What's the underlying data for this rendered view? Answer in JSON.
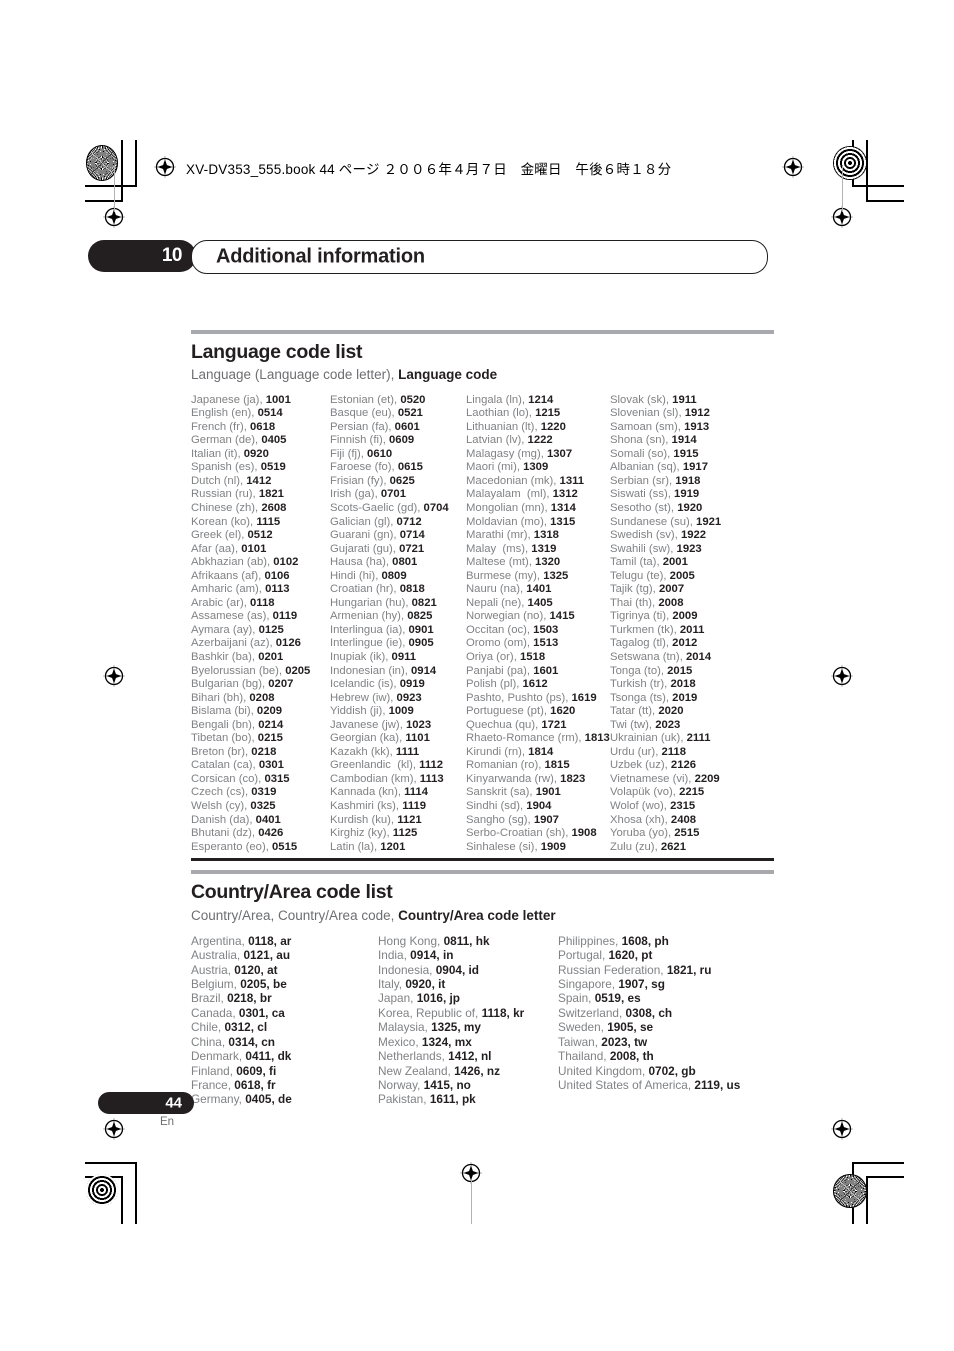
{
  "book_header": "XV-DV353_555.book  44 ページ  ２００６年４月７日　金曜日　午後６時１８分",
  "chapter": {
    "number": "10",
    "title": "Additional information"
  },
  "footer": {
    "page_number": "44",
    "language_mark": "En"
  },
  "sections": [
    {
      "id": "language-code-list",
      "title": "Language code list",
      "subtitle_plain": "Language (Language code letter), ",
      "subtitle_bold": "Language code",
      "columns": [
        [
          {
            "name": "Japanese (ja), ",
            "code": "1001"
          },
          {
            "name": "English (en), ",
            "code": "0514"
          },
          {
            "name": "French (fr), ",
            "code": "0618"
          },
          {
            "name": "German (de), ",
            "code": "0405"
          },
          {
            "name": "Italian (it), ",
            "code": "0920"
          },
          {
            "name": "Spanish (es), ",
            "code": "0519"
          },
          {
            "name": "Dutch (nl), ",
            "code": "1412"
          },
          {
            "name": "Russian (ru), ",
            "code": "1821"
          },
          {
            "name": "Chinese (zh), ",
            "code": "2608"
          },
          {
            "name": "Korean (ko), ",
            "code": "1115"
          },
          {
            "name": "Greek (el), ",
            "code": "0512"
          },
          {
            "name": "Afar (aa), ",
            "code": "0101"
          },
          {
            "name": "Abkhazian (ab), ",
            "code": "0102"
          },
          {
            "name": "Afrikaans (af), ",
            "code": "0106"
          },
          {
            "name": "Amharic (am), ",
            "code": "0113"
          },
          {
            "name": "Arabic (ar), ",
            "code": "0118"
          },
          {
            "name": "Assamese (as), ",
            "code": "0119"
          },
          {
            "name": "Aymara (ay), ",
            "code": "0125"
          },
          {
            "name": "Azerbaijani (az), ",
            "code": "0126"
          },
          {
            "name": "Bashkir (ba), ",
            "code": "0201"
          },
          {
            "name": "Byelorussian (be), ",
            "code": "0205"
          },
          {
            "name": "Bulgarian (bg), ",
            "code": "0207"
          },
          {
            "name": "Bihari (bh), ",
            "code": "0208"
          },
          {
            "name": "Bislama (bi), ",
            "code": "0209"
          },
          {
            "name": "Bengali (bn), ",
            "code": "0214"
          },
          {
            "name": "Tibetan (bo), ",
            "code": "0215"
          },
          {
            "name": "Breton (br), ",
            "code": "0218"
          },
          {
            "name": "Catalan (ca), ",
            "code": "0301"
          },
          {
            "name": "Corsican (co), ",
            "code": "0315"
          },
          {
            "name": "Czech (cs), ",
            "code": "0319"
          },
          {
            "name": "Welsh (cy), ",
            "code": "0325"
          },
          {
            "name": "Danish (da), ",
            "code": "0401"
          },
          {
            "name": "Bhutani (dz), ",
            "code": "0426"
          },
          {
            "name": "Esperanto (eo), ",
            "code": "0515"
          }
        ],
        [
          {
            "name": "Estonian (et), ",
            "code": "0520"
          },
          {
            "name": "Basque (eu), ",
            "code": "0521"
          },
          {
            "name": "Persian (fa), ",
            "code": "0601"
          },
          {
            "name": "Finnish (fi), ",
            "code": "0609"
          },
          {
            "name": "Fiji (fj), ",
            "code": "0610"
          },
          {
            "name": "Faroese (fo), ",
            "code": "0615"
          },
          {
            "name": "Frisian (fy), ",
            "code": "0625"
          },
          {
            "name": "Irish (ga), ",
            "code": "0701"
          },
          {
            "name": "Scots-Gaelic (gd), ",
            "code": "0704"
          },
          {
            "name": "Galician (gl), ",
            "code": "0712"
          },
          {
            "name": "Guarani (gn), ",
            "code": "0714"
          },
          {
            "name": "Gujarati (gu), ",
            "code": "0721"
          },
          {
            "name": "Hausa (ha), ",
            "code": "0801"
          },
          {
            "name": "Hindi (hi), ",
            "code": "0809"
          },
          {
            "name": "Croatian (hr), ",
            "code": "0818"
          },
          {
            "name": "Hungarian (hu), ",
            "code": "0821"
          },
          {
            "name": "Armenian (hy), ",
            "code": "0825"
          },
          {
            "name": "Interlingua (ia), ",
            "code": "0901"
          },
          {
            "name": "Interlingue (ie), ",
            "code": "0905"
          },
          {
            "name": "Inupiak (ik), ",
            "code": "0911"
          },
          {
            "name": "Indonesian (in), ",
            "code": "0914"
          },
          {
            "name": "Icelandic (is), ",
            "code": "0919"
          },
          {
            "name": "Hebrew (iw), ",
            "code": "0923"
          },
          {
            "name": "Yiddish (ji), ",
            "code": "1009"
          },
          {
            "name": "Javanese (jw), ",
            "code": "1023"
          },
          {
            "name": "Georgian (ka), ",
            "code": "1101"
          },
          {
            "name": "Kazakh (kk), ",
            "code": "1111"
          },
          {
            "name": "Greenlandic  (kl), ",
            "code": "1112"
          },
          {
            "name": "Cambodian (km), ",
            "code": "1113"
          },
          {
            "name": "Kannada (kn), ",
            "code": "1114"
          },
          {
            "name": "Kashmiri (ks), ",
            "code": "1119"
          },
          {
            "name": "Kurdish (ku), ",
            "code": "1121"
          },
          {
            "name": "Kirghiz (ky), ",
            "code": "1125"
          },
          {
            "name": "Latin (la), ",
            "code": "1201"
          }
        ],
        [
          {
            "name": "Lingala (ln), ",
            "code": "1214"
          },
          {
            "name": "Laothian (lo), ",
            "code": "1215"
          },
          {
            "name": "Lithuanian (lt), ",
            "code": "1220"
          },
          {
            "name": "Latvian (lv), ",
            "code": "1222"
          },
          {
            "name": "Malagasy (mg), ",
            "code": "1307"
          },
          {
            "name": "Maori (mi), ",
            "code": "1309"
          },
          {
            "name": "Macedonian (mk), ",
            "code": "1311"
          },
          {
            "name": "Malayalam  (ml), ",
            "code": "1312"
          },
          {
            "name": "Mongolian (mn), ",
            "code": "1314"
          },
          {
            "name": "Moldavian (mo), ",
            "code": "1315"
          },
          {
            "name": "Marathi (mr), ",
            "code": "1318"
          },
          {
            "name": "Malay  (ms), ",
            "code": "1319"
          },
          {
            "name": "Maltese (mt), ",
            "code": "1320"
          },
          {
            "name": "Burmese (my), ",
            "code": "1325"
          },
          {
            "name": "Nauru (na), ",
            "code": "1401"
          },
          {
            "name": "Nepali (ne), ",
            "code": "1405"
          },
          {
            "name": "Norwegian (no), ",
            "code": "1415"
          },
          {
            "name": "Occitan (oc), ",
            "code": "1503"
          },
          {
            "name": "Oromo (om), ",
            "code": "1513"
          },
          {
            "name": "Oriya (or), ",
            "code": "1518"
          },
          {
            "name": "Panjabi (pa), ",
            "code": "1601"
          },
          {
            "name": "Polish (pl), ",
            "code": "1612"
          },
          {
            "name": "Pashto, Pushto (ps), ",
            "code": "1619"
          },
          {
            "name": "Portuguese (pt), ",
            "code": "1620"
          },
          {
            "name": "Quechua (qu), ",
            "code": "1721"
          },
          {
            "name": "Rhaeto-Romance (rm), ",
            "code": "1813"
          },
          {
            "name": "Kirundi (rn), ",
            "code": "1814"
          },
          {
            "name": "Romanian (ro), ",
            "code": "1815"
          },
          {
            "name": "Kinyarwanda (rw), ",
            "code": "1823"
          },
          {
            "name": "Sanskrit (sa), ",
            "code": "1901"
          },
          {
            "name": "Sindhi (sd), ",
            "code": "1904"
          },
          {
            "name": "Sangho (sg), ",
            "code": "1907"
          },
          {
            "name": "Serbo-Croatian (sh), ",
            "code": "1908"
          },
          {
            "name": "Sinhalese (si), ",
            "code": "1909"
          }
        ],
        [
          {
            "name": "Slovak (sk), ",
            "code": "1911"
          },
          {
            "name": "Slovenian (sl), ",
            "code": "1912"
          },
          {
            "name": "Samoan (sm), ",
            "code": "1913"
          },
          {
            "name": "Shona (sn), ",
            "code": "1914"
          },
          {
            "name": "Somali (so), ",
            "code": "1915"
          },
          {
            "name": "Albanian (sq), ",
            "code": "1917"
          },
          {
            "name": "Serbian (sr), ",
            "code": "1918"
          },
          {
            "name": "Siswati (ss), ",
            "code": "1919"
          },
          {
            "name": "Sesotho (st), ",
            "code": "1920"
          },
          {
            "name": "Sundanese (su), ",
            "code": "1921"
          },
          {
            "name": "Swedish (sv), ",
            "code": "1922"
          },
          {
            "name": "Swahili (sw), ",
            "code": "1923"
          },
          {
            "name": "Tamil (ta), ",
            "code": "2001"
          },
          {
            "name": "Telugu (te), ",
            "code": "2005"
          },
          {
            "name": "Tajik (tg), ",
            "code": "2007"
          },
          {
            "name": "Thai (th), ",
            "code": "2008"
          },
          {
            "name": "Tigrinya (ti), ",
            "code": "2009"
          },
          {
            "name": "Turkmen (tk), ",
            "code": "2011"
          },
          {
            "name": "Tagalog (tl), ",
            "code": "2012"
          },
          {
            "name": "Setswana (tn), ",
            "code": "2014"
          },
          {
            "name": "Tonga (to), ",
            "code": "2015"
          },
          {
            "name": "Turkish (tr), ",
            "code": "2018"
          },
          {
            "name": "Tsonga (ts), ",
            "code": "2019"
          },
          {
            "name": "Tatar (tt), ",
            "code": "2020"
          },
          {
            "name": "Twi (tw), ",
            "code": "2023"
          },
          {
            "name": "Ukrainian (uk), ",
            "code": "2111"
          },
          {
            "name": "Urdu (ur), ",
            "code": "2118"
          },
          {
            "name": "Uzbek (uz), ",
            "code": "2126"
          },
          {
            "name": "Vietnamese (vi), ",
            "code": "2209"
          },
          {
            "name": "Volapük (vo), ",
            "code": "2215"
          },
          {
            "name": "Wolof (wo), ",
            "code": "2315"
          },
          {
            "name": "Xhosa (xh), ",
            "code": "2408"
          },
          {
            "name": "Yoruba (yo), ",
            "code": "2515"
          },
          {
            "name": "Zulu (zu), ",
            "code": "2621"
          }
        ]
      ]
    },
    {
      "id": "country-area-code-list",
      "title": "Country/Area code list",
      "subtitle_plain": "Country/Area, Country/Area code, ",
      "subtitle_bold": "Country/Area code letter",
      "columns": [
        [
          {
            "name": "Argentina, ",
            "code": "0118, ar"
          },
          {
            "name": "Australia, ",
            "code": "0121, au"
          },
          {
            "name": "Austria, ",
            "code": "0120, at"
          },
          {
            "name": "Belgium, ",
            "code": "0205, be"
          },
          {
            "name": "Brazil, ",
            "code": "0218, br"
          },
          {
            "name": "Canada, ",
            "code": "0301, ca"
          },
          {
            "name": "Chile, ",
            "code": "0312, cl"
          },
          {
            "name": "China, ",
            "code": "0314, cn"
          },
          {
            "name": "Denmark, ",
            "code": "0411, dk"
          },
          {
            "name": "Finland, ",
            "code": "0609, fi"
          },
          {
            "name": "France, ",
            "code": "0618, fr"
          },
          {
            "name": "Germany, ",
            "code": "0405, de"
          }
        ],
        [
          {
            "name": "Hong Kong, ",
            "code": "0811, hk"
          },
          {
            "name": "India, ",
            "code": "0914, in"
          },
          {
            "name": "Indonesia, ",
            "code": "0904, id"
          },
          {
            "name": "Italy, ",
            "code": "0920, it"
          },
          {
            "name": "Japan, ",
            "code": "1016, jp"
          },
          {
            "name": "Korea, Republic of, ",
            "code": "1118, kr"
          },
          {
            "name": "Malaysia, ",
            "code": "1325, my"
          },
          {
            "name": "Mexico, ",
            "code": "1324, mx"
          },
          {
            "name": "Netherlands, ",
            "code": "1412, nl"
          },
          {
            "name": "New Zealand, ",
            "code": "1426, nz"
          },
          {
            "name": "Norway, ",
            "code": "1415, no"
          },
          {
            "name": "Pakistan, ",
            "code": "1611, pk"
          }
        ],
        [
          {
            "name": "Philippines, ",
            "code": "1608, ph"
          },
          {
            "name": "Portugal, ",
            "code": "1620, pt"
          },
          {
            "name": "Russian Federation, ",
            "code": "1821, ru"
          },
          {
            "name": "Singapore, ",
            "code": "1907, sg"
          },
          {
            "name": "Spain, ",
            "code": "0519, es"
          },
          {
            "name": "Switzerland, ",
            "code": "0308, ch"
          },
          {
            "name": "Sweden, ",
            "code": "1905, se"
          },
          {
            "name": "Taiwan, ",
            "code": "2023, tw"
          },
          {
            "name": "Thailand, ",
            "code": "2008, th"
          },
          {
            "name": "United Kingdom, ",
            "code": "0702, gb"
          },
          {
            "name": "United States of America, ",
            "code": "2119, us"
          }
        ]
      ]
    }
  ]
}
